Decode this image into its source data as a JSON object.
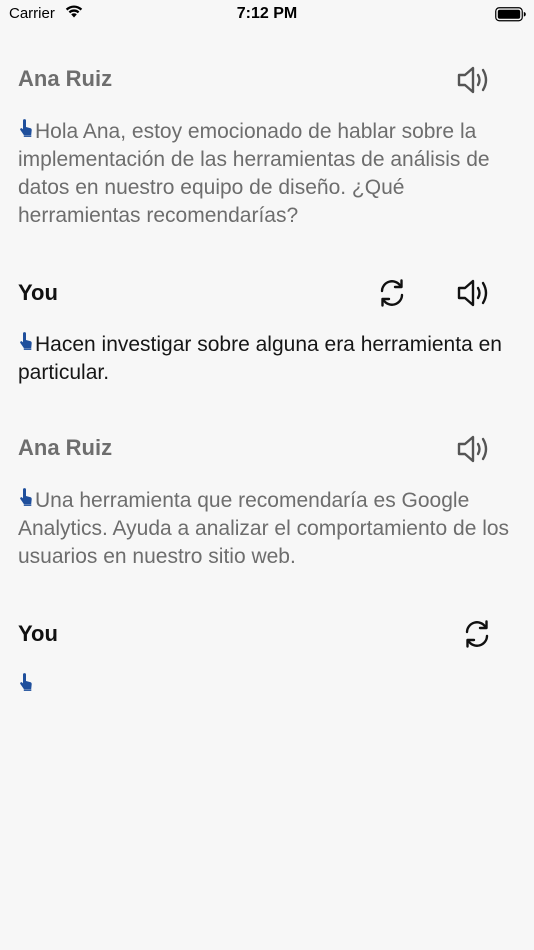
{
  "status": {
    "carrier": "Carrier",
    "time": "7:12 PM"
  },
  "messages": [
    {
      "speaker": "Ana Ruiz",
      "text": "Hola Ana, estoy emocionado de hablar sobre la implementación de las herramientas de análisis de datos en nuestro equipo de diseño. ¿Qué herramientas recomendarías?"
    },
    {
      "speaker": "You",
      "text": "Hacen investigar sobre alguna era herramienta en particular."
    },
    {
      "speaker": "Ana Ruiz",
      "text": "Una herramienta que recomendaría es Google  Analytics. Ayuda a analizar el comportamiento de los usuarios en nuestro sitio web."
    },
    {
      "speaker": "You",
      "text": ""
    }
  ],
  "colors": {
    "background": "#f7f7f7",
    "ai_text": "#6d6d6d",
    "user_text": "#161616",
    "hand_icon": "#1f4f9c"
  },
  "icons": {
    "speaker": "speaker-icon",
    "refresh": "refresh-icon",
    "hand": "hand-pointer-icon"
  }
}
